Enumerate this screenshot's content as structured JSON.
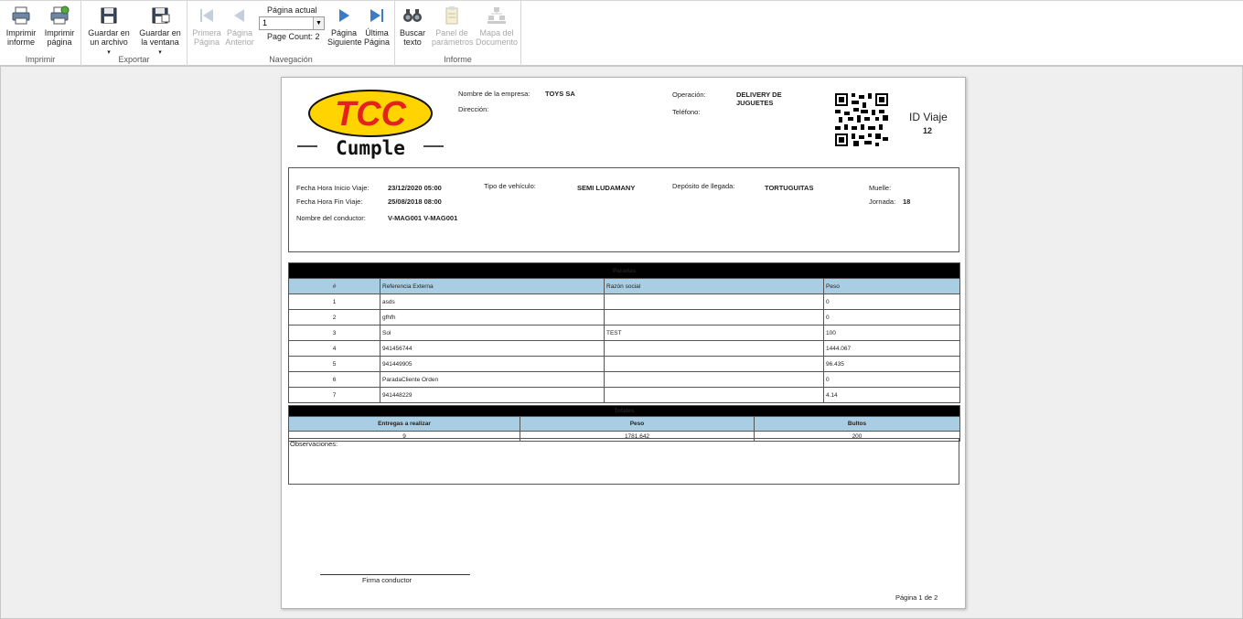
{
  "toolbar": {
    "imprimir": {
      "label": "Imprimir",
      "buttons": [
        {
          "label": "Imprimir\ninforme",
          "icon": "printer-icon"
        },
        {
          "label": "Imprimir\npágina",
          "icon": "print-page-icon"
        }
      ]
    },
    "exportar": {
      "label": "Exportar",
      "buttons": [
        {
          "label": "Guardar en\nun archivo",
          "icon": "save-file-icon"
        },
        {
          "label": "Guardar en\nla ventana",
          "icon": "save-window-icon"
        }
      ]
    },
    "navegacion": {
      "label": "Navegación",
      "first": "Primera\nPágina",
      "prev": "Página\nAnterior",
      "next": "Página\nSiguiente",
      "last": "Última\nPágina",
      "current_page_label": "Página actual",
      "current_page_value": "1",
      "page_count": "Page Count: 2"
    },
    "informe": {
      "label": "Informe",
      "buttons": [
        {
          "label": "Buscar\ntexto",
          "icon": "binoculars-icon"
        },
        {
          "label": "Panel de\nparámetros",
          "icon": "parameters-icon"
        },
        {
          "label": "Mapa del\nDocumento",
          "icon": "document-map-icon"
        }
      ]
    }
  },
  "report": {
    "logo": {
      "top": "TCC",
      "bottom": "Cumple"
    },
    "empresa_label": "Nombre de la empresa:",
    "empresa_value": "TOYS SA",
    "direccion_label": "Dirección:",
    "operacion_label": "Operación:",
    "operacion_value_1": "DELIVERY DE",
    "operacion_value_2": "JUGUETES",
    "telefono_label": "Teléfono:",
    "id_viaje_label": "ID Viaje",
    "id_viaje_value": "12",
    "fecha_inicio_label": "Fecha Hora Inicio Viaje:",
    "fecha_inicio_value": "23/12/2020 05:00",
    "fecha_fin_label": "Fecha Hora Fin Viaje:",
    "fecha_fin_value": "25/08/2018 08:00",
    "conductor_label": "Nombre del conductor:",
    "conductor_value": "V-MAG001 V-MAG001",
    "vehiculo_label": "Tipo de vehículo:",
    "vehiculo_value": "SEMI LUDAMANY",
    "deposito_label": "Depósito de llegada:",
    "deposito_value": "TORTUGUITAS",
    "muelle_label": "Muelle:",
    "jornada_label": "Jornada:",
    "jornada_value": "18",
    "paradas": {
      "title": "Paradas",
      "columns": [
        "#",
        "Referencia Externa",
        "Razón social",
        "Peso"
      ],
      "rows": [
        [
          "1",
          "asds",
          "",
          "0"
        ],
        [
          "2",
          "gfhfh",
          "",
          "0"
        ],
        [
          "3",
          "Sol",
          "TEST",
          "100"
        ],
        [
          "4",
          "941456744",
          "",
          "1444.067"
        ],
        [
          "5",
          "941449905",
          "",
          "96.435"
        ],
        [
          "6",
          "ParadaCliente Orden",
          "",
          "0"
        ],
        [
          "7",
          "941448229",
          "",
          "4.14"
        ]
      ]
    },
    "totales": {
      "title": "Totales",
      "columns": [
        "Entregas a realizar",
        "Peso",
        "Bultos"
      ],
      "values": [
        "9",
        "1781.642",
        "200"
      ]
    },
    "observaciones_label": "Observaciones:",
    "firma_label": "Firma conductor",
    "pagina_label": "Página 1 de 2"
  },
  "colors": {
    "header_black": "#000000",
    "header_blue": "#a9cde3",
    "logo_red": "#e3231b",
    "logo_yellow": "#ffd400"
  }
}
